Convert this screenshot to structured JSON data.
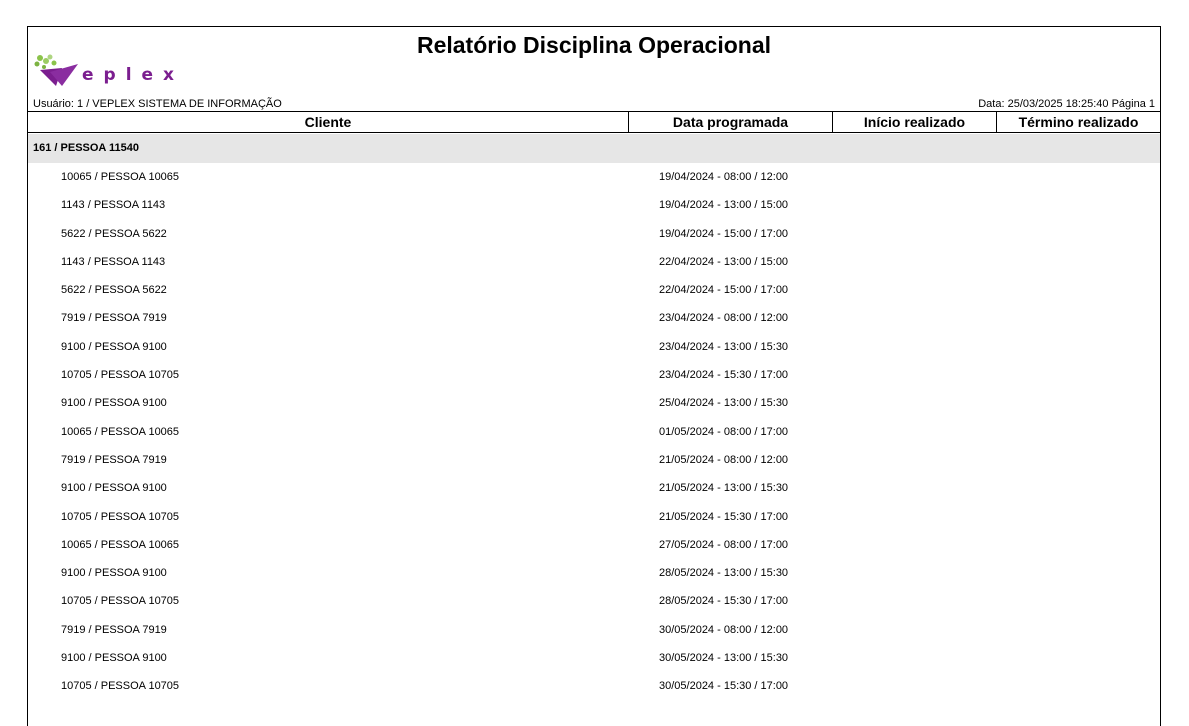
{
  "report": {
    "title": "Relatório Disciplina Operacional",
    "logo_text": "eplex",
    "user_info": "Usuário: 1 / VEPLEX SISTEMA DE INFORMAÇÃO",
    "date_info": "Data: 25/03/2025 18:25:40 Página 1"
  },
  "columns": {
    "cliente": "Cliente",
    "data_programada": "Data programada",
    "inicio_realizado": "Início realizado",
    "termino_realizado": "Término realizado"
  },
  "group": {
    "label": "161 / PESSOA 11540"
  },
  "rows": [
    {
      "cliente": "10065 / PESSOA 10065",
      "data": "19/04/2024 - 08:00 / 12:00"
    },
    {
      "cliente": "1143 / PESSOA 1143",
      "data": "19/04/2024 - 13:00 / 15:00"
    },
    {
      "cliente": "5622 / PESSOA 5622",
      "data": "19/04/2024 - 15:00 / 17:00"
    },
    {
      "cliente": "1143 / PESSOA 1143",
      "data": "22/04/2024 - 13:00 / 15:00"
    },
    {
      "cliente": "5622 / PESSOA 5622",
      "data": "22/04/2024 - 15:00 / 17:00"
    },
    {
      "cliente": "7919 / PESSOA 7919",
      "data": "23/04/2024 - 08:00 / 12:00"
    },
    {
      "cliente": "9100 / PESSOA 9100",
      "data": "23/04/2024 - 13:00 / 15:30"
    },
    {
      "cliente": "10705 / PESSOA 10705",
      "data": "23/04/2024 - 15:30 / 17:00"
    },
    {
      "cliente": "9100 / PESSOA 9100",
      "data": "25/04/2024 - 13:00 / 15:30"
    },
    {
      "cliente": "10065 / PESSOA 10065",
      "data": "01/05/2024 - 08:00 / 17:00"
    },
    {
      "cliente": "7919 / PESSOA 7919",
      "data": "21/05/2024 - 08:00 / 12:00"
    },
    {
      "cliente": "9100 / PESSOA 9100",
      "data": "21/05/2024 - 13:00 / 15:30"
    },
    {
      "cliente": "10705 / PESSOA 10705",
      "data": "21/05/2024 - 15:30 / 17:00"
    },
    {
      "cliente": "10065 / PESSOA 10065",
      "data": "27/05/2024 - 08:00 / 17:00"
    },
    {
      "cliente": "9100 / PESSOA 9100",
      "data": "28/05/2024 - 13:00 / 15:30"
    },
    {
      "cliente": "10705 / PESSOA 10705",
      "data": "28/05/2024 - 15:30 / 17:00"
    },
    {
      "cliente": "7919 / PESSOA 7919",
      "data": "30/05/2024 - 08:00 / 12:00"
    },
    {
      "cliente": "9100 / PESSOA 9100",
      "data": "30/05/2024 - 13:00 / 15:30"
    },
    {
      "cliente": "10705 / PESSOA 10705",
      "data": "30/05/2024 - 15:30 / 17:00"
    }
  ]
}
